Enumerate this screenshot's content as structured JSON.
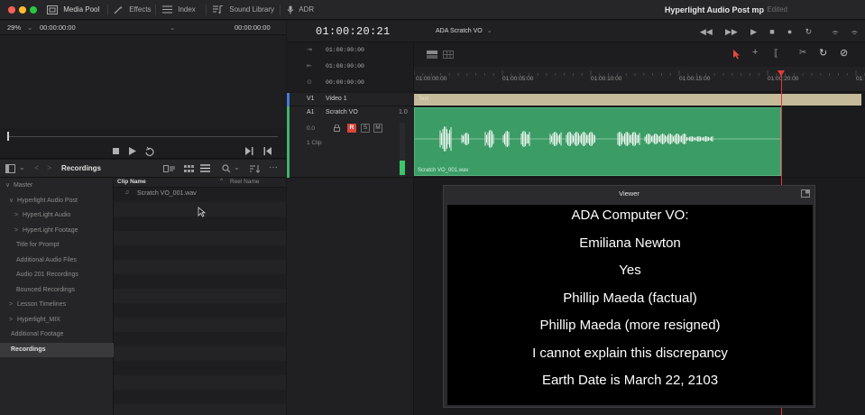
{
  "titlebar": {
    "media_pool": "Media Pool",
    "effects": "Effects",
    "index": "Index",
    "sound_library": "Sound Library",
    "adr": "ADR",
    "project": "Hyperlight Audio Post mp",
    "status": "Edited"
  },
  "source": {
    "zoom": "29%",
    "timecode_in": "00:00:00:00",
    "timecode_out": "00:00:00:00"
  },
  "media_pool": {
    "current_bin": "Recordings",
    "bins": [
      {
        "label": "Master",
        "prefix": "∨"
      },
      {
        "label": "Hyperlight Audio Post",
        "prefix": "∨"
      },
      {
        "label": "HyperLight Audio",
        "prefix": ">"
      },
      {
        "label": "HyperLight Footage",
        "prefix": ">"
      },
      {
        "label": "Title for Prompt",
        "prefix": ""
      },
      {
        "label": "Additional Audio Files",
        "prefix": ""
      },
      {
        "label": "Audio 201 Recordings",
        "prefix": ""
      },
      {
        "label": "Bounced Recordings",
        "prefix": ""
      },
      {
        "label": "Lesson Timelines",
        "prefix": ">"
      },
      {
        "label": "Hyperlight_MIX",
        "prefix": ">"
      },
      {
        "label": "Additional Footage",
        "prefix": ""
      },
      {
        "label": "Recordings",
        "prefix": ""
      }
    ],
    "col_clip_name": "Clip Name",
    "col_reel_name": "Reel Name",
    "clips": [
      "Scratch VO_001.wav"
    ]
  },
  "timeline": {
    "timecode": "01:00:20:21",
    "name": "ADA Scratch VO",
    "tc_rows": [
      "01:00:00:00",
      "01:00:00:00",
      "00:00:00:00"
    ],
    "ruler": [
      "01:00:00:00",
      "01:00:05:00",
      "01:00:10:00",
      "01:00:15:00",
      "01:00:20:00",
      "01:"
    ],
    "video_track": {
      "id": "V1",
      "name": "Video 1",
      "clip": "Text"
    },
    "audio_track": {
      "id": "A1",
      "name": "Scratch VO",
      "format": "1.0",
      "level": "0.0",
      "clip_count": "1 Clip",
      "clip": "Scratch VO_001.wav"
    },
    "buttons": {
      "r": "R",
      "s": "S",
      "m": "M"
    }
  },
  "viewer": {
    "title": "Viewer",
    "lines": [
      "ADA Computer VO:",
      "Emiliana Newton",
      "Yes",
      "Phillip Maeda (factual)",
      "Phillip Maeda (more resigned)",
      "I cannot explain this discrepancy",
      "Earth Date is March 22, 2103"
    ]
  },
  "colors": {
    "audio_clip": "#3b9c66",
    "video_clip": "#c5ba9a",
    "playhead": "#e03a3a",
    "record_button": "#d9443c"
  }
}
